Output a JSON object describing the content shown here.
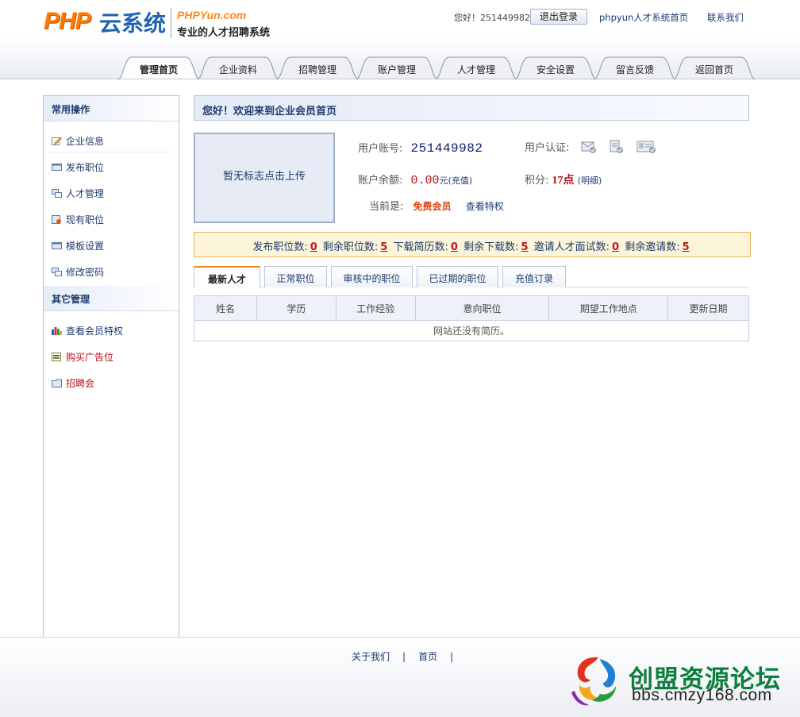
{
  "header": {
    "logo": {
      "php": "PHP",
      "yun": "云系统",
      "site": "PHPYun.com",
      "slogan": "专业的人才招聘系统"
    },
    "greeting": "您好！251449982",
    "logout_label": "退出登录",
    "home_link": "phpyun人才系统首页",
    "contact_link": "联系我们"
  },
  "nav": {
    "tabs": [
      {
        "label": "管理首页",
        "active": true
      },
      {
        "label": "企业资料"
      },
      {
        "label": "招聘管理"
      },
      {
        "label": "账户管理"
      },
      {
        "label": "人才管理"
      },
      {
        "label": "安全设置"
      },
      {
        "label": "留言反馈"
      },
      {
        "label": "返回首页"
      }
    ]
  },
  "sidebar": {
    "section1_title": "常用操作",
    "section1_items": [
      {
        "label": "企业信息",
        "icon": "edit-icon"
      },
      {
        "label": "发布职位",
        "icon": "window-icon"
      },
      {
        "label": "人才管理",
        "icon": "users-icon"
      },
      {
        "label": "现有职位",
        "icon": "job-list-icon"
      },
      {
        "label": "模板设置",
        "icon": "template-icon"
      },
      {
        "label": "修改密码",
        "icon": "password-icon"
      }
    ],
    "section2_title": "其它管理",
    "section2_items": [
      {
        "label": "查看会员特权",
        "icon": "bar-chart-icon"
      },
      {
        "label": "购买广告位",
        "icon": "ad-icon"
      },
      {
        "label": "招聘会",
        "icon": "folder-icon"
      }
    ]
  },
  "main": {
    "title": "您好！欢迎来到企业会员首页",
    "logo_placeholder": "暂无标志点击上传",
    "account_label": "用户账号:",
    "account_value": "251449982",
    "cert_label": "用户认证:",
    "balance_label": "账户余额:",
    "balance_value": "0.00",
    "balance_unit": "元",
    "recharge_link": "(充值)",
    "points_label": "积分:",
    "points_value": "17点",
    "points_detail": "(明细)",
    "member_label": "当前是:",
    "member_type": "免费会员",
    "privilege_link": "查看特权"
  },
  "stats": {
    "items": [
      {
        "label": "发布职位数:",
        "value": "0"
      },
      {
        "label": "剩余职位数:",
        "value": "5"
      },
      {
        "label": "下载简历数:",
        "value": "0"
      },
      {
        "label": "剩余下载数:",
        "value": "5"
      },
      {
        "label": "邀请人才面试数:",
        "value": "0"
      },
      {
        "label": "剩余邀请数:",
        "value": "5"
      }
    ]
  },
  "subtabs": [
    {
      "label": "最新人才",
      "active": true
    },
    {
      "label": "正常职位"
    },
    {
      "label": "审核中的职位"
    },
    {
      "label": "已过期的职位"
    },
    {
      "label": "充值订录"
    }
  ],
  "table": {
    "columns": [
      "姓名",
      "学历",
      "工作经验",
      "意向职位",
      "期望工作地点",
      "更新日期"
    ],
    "empty_message": "网站还没有简历。"
  },
  "footer": {
    "about_link": "关于我们",
    "home_link": "首页",
    "separator": "|"
  },
  "watermark": {
    "title": "创盟资源论坛",
    "url": "bbs.cmzy168.com"
  },
  "colors": {
    "accent_orange": "#f08a1c",
    "link_blue": "#1d3a6e",
    "alert_red": "#b5121b",
    "watermark_green": "#0d7e3c"
  }
}
